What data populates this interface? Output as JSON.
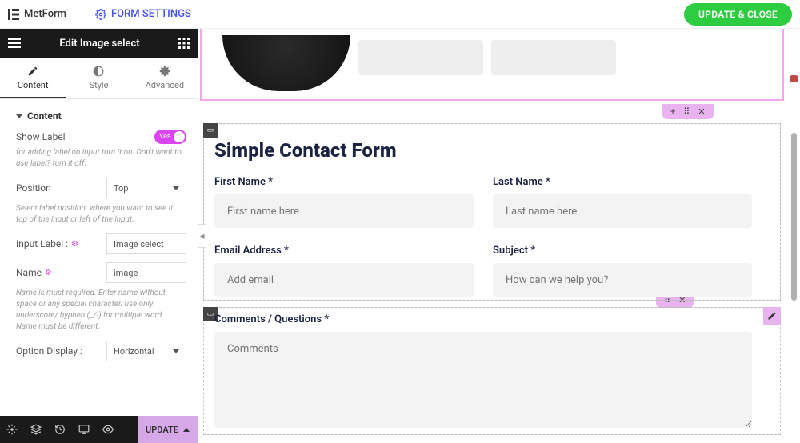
{
  "topbar": {
    "app": "MetForm",
    "formSettings": "FORM SETTINGS",
    "updateClose": "UPDATE & CLOSE"
  },
  "panel": {
    "title": "Edit Image select",
    "tabs": {
      "content": "Content",
      "style": "Style",
      "advanced": "Advanced"
    },
    "section": "Content",
    "showLabel": {
      "label": "Show Label",
      "value": "Yes",
      "help": "for adding label on input turn it on. Don't want to use label? turn it off."
    },
    "position": {
      "label": "Position",
      "value": "Top",
      "help": "Select label position. where you want to see it. top of the input or left of the input."
    },
    "inputLabel": {
      "label": "Input Label :",
      "value": "Image select"
    },
    "name": {
      "label": "Name",
      "value": "image",
      "help": "Name is must required. Enter name without space or any special character. use only underscore/ hyphen (_/-) for multiple word. Name must be different."
    },
    "optionDisplay": {
      "label": "Option Display :",
      "value": "Horizontal"
    },
    "footer": {
      "update": "UPDATE"
    }
  },
  "canvas": {
    "formTitle": "Simple Contact Form",
    "fields": {
      "firstName": {
        "label": "First Name *",
        "placeholder": "First name here"
      },
      "lastName": {
        "label": "Last Name *",
        "placeholder": "Last name here"
      },
      "email": {
        "label": "Email Address *",
        "placeholder": "Add email"
      },
      "subject": {
        "label": "Subject *",
        "placeholder": "How can we help you?"
      },
      "comments": {
        "label": "Comments / Questions *",
        "placeholder": "Comments"
      }
    }
  }
}
